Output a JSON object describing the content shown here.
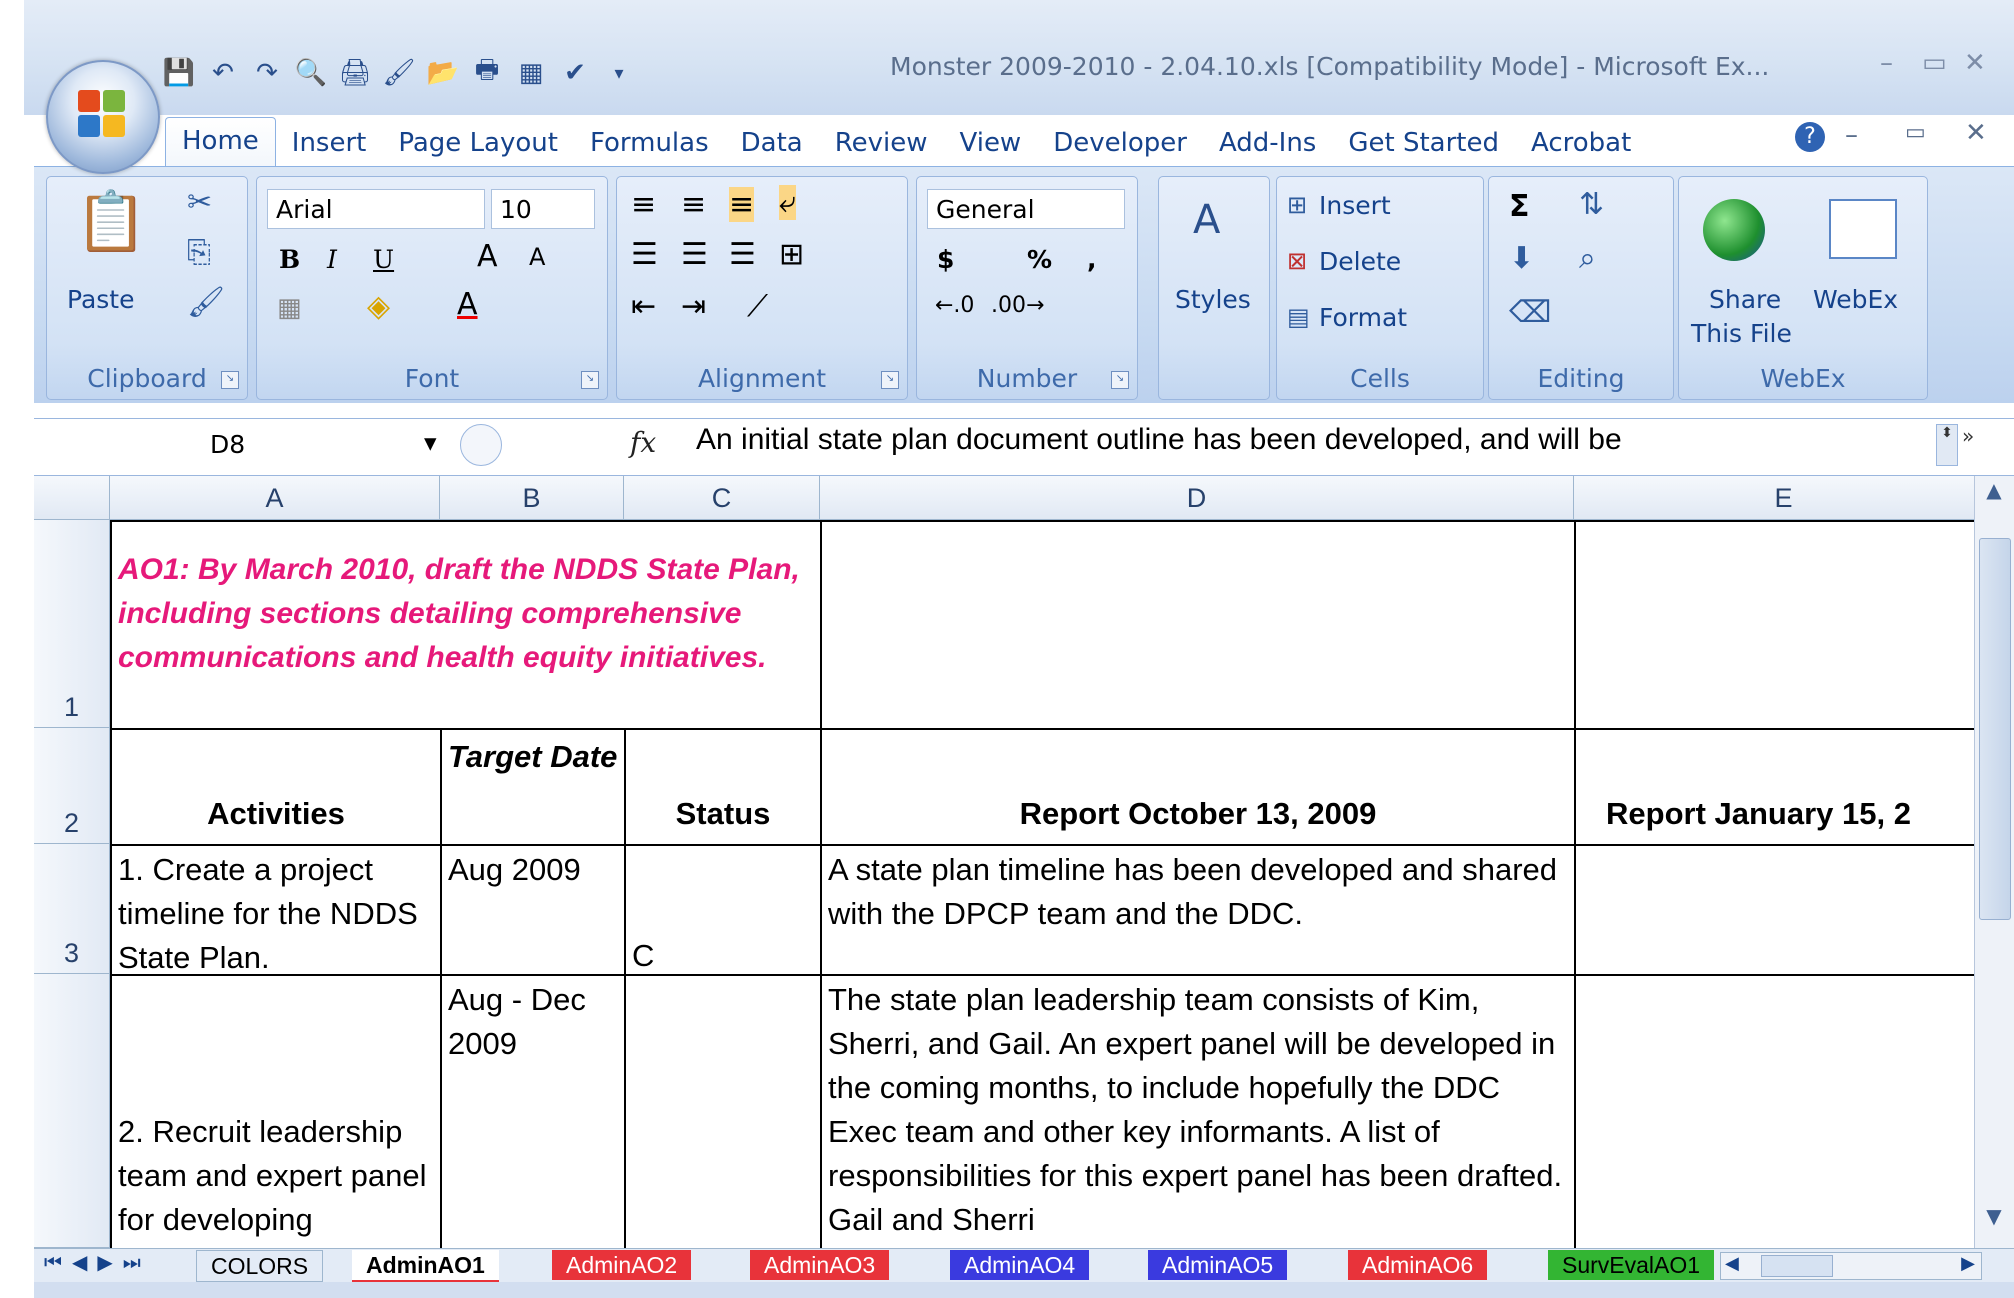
{
  "window": {
    "title": "Monster 2009-2010 - 2.04.10.xls  [Compatibility Mode] - Microsoft Ex...",
    "controls": [
      "–",
      "▭",
      "✕"
    ]
  },
  "tabs": [
    "Home",
    "Insert",
    "Page Layout",
    "Formulas",
    "Data",
    "Review",
    "View",
    "Developer",
    "Add-Ins",
    "Get Started",
    "Acrobat"
  ],
  "ribbon": {
    "clipboard": {
      "label": "Clipboard",
      "paste": "Paste"
    },
    "font": {
      "label": "Font",
      "name": "Arial",
      "size": "10",
      "bold": "B",
      "italic": "I",
      "underline": "U"
    },
    "alignment": {
      "label": "Alignment"
    },
    "number": {
      "label": "Number",
      "format": "General",
      "currency": "$",
      "percent": "%",
      "comma": ","
    },
    "styles": {
      "label": "Styles"
    },
    "cells": {
      "label": "Cells",
      "insert": "Insert",
      "delete": "Delete",
      "format": "Format"
    },
    "editing": {
      "label": "Editing",
      "sigma": "Σ"
    },
    "webex": {
      "label": "WebEx",
      "share_line1": "Share",
      "share_line2": "This File",
      "webex": "WebEx"
    }
  },
  "formula_bar": {
    "name_box": "D8",
    "fx": "fx",
    "content": "An initial state plan document outline has been developed, and will be"
  },
  "columns": [
    "A",
    "B",
    "C",
    "D",
    "E"
  ],
  "rows": [
    "1",
    "2",
    "3"
  ],
  "cells": {
    "a1": "AO1:  By March 2010, draft the NDDS State Plan, including sections detailing comprehensive communications and health equity initiatives.",
    "a2": "Activities",
    "b2": "Target Date",
    "c2": "Status",
    "d2": "Report October 13, 2009",
    "e2": "Report January 15, 2",
    "a3": "1. Create a project timeline for the NDDS State Plan.",
    "b3": "Aug 2009",
    "c3": "C",
    "d3": "A state plan timeline has been developed and shared with the DPCP team and the DDC.",
    "a4": "2. Recruit leadership team and expert panel for developing",
    "b4": "Aug - Dec 2009",
    "d4": "The state plan leadership team consists of Kim, Sherri, and Gail.  An expert panel will be developed in the coming months, to include hopefully the DDC Exec team and other key informants.  A list of responsibilities for this expert panel has been drafted.  Gail and Sherri"
  },
  "sheet_tabs": [
    {
      "name": "COLORS",
      "color": "#e3ebf6"
    },
    {
      "name": "AdminAO1",
      "color": "#ffffff"
    },
    {
      "name": "AdminAO2",
      "color": "#e8333a"
    },
    {
      "name": "AdminAO3",
      "color": "#e8333a"
    },
    {
      "name": "AdminAO4",
      "color": "#3a3adf"
    },
    {
      "name": "AdminAO5",
      "color": "#3a3adf"
    },
    {
      "name": "AdminAO6",
      "color": "#e8333a"
    },
    {
      "name": "SurvEvalAO1",
      "color": "#33b533"
    }
  ],
  "colors": {
    "accent_magenta": "#e6197a",
    "ribbon_blue": "#c6d9f1"
  }
}
